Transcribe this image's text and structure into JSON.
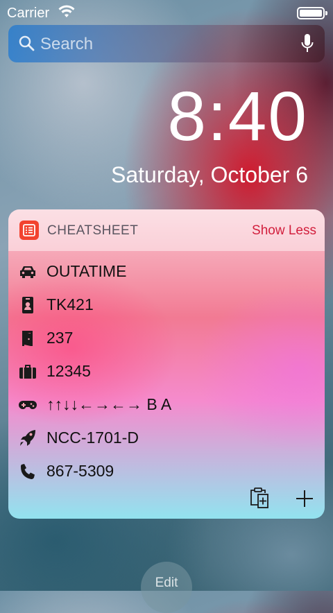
{
  "status_bar": {
    "carrier": "Carrier"
  },
  "search": {
    "placeholder": "Search"
  },
  "lockscreen": {
    "time": "8:40",
    "date": "Saturday, October 6"
  },
  "widget": {
    "app_name": "CHEATSHEET",
    "toggle_label": "Show Less",
    "items": [
      {
        "icon": "car-icon",
        "value": "OUTATIME"
      },
      {
        "icon": "id-badge-icon",
        "value": "TK421"
      },
      {
        "icon": "door-icon",
        "value": "237"
      },
      {
        "icon": "suitcase-icon",
        "value": "12345"
      },
      {
        "icon": "gamepad-icon",
        "value": "↑↑↓↓←→←→ B A"
      },
      {
        "icon": "rocket-icon",
        "value": "NCC-1701-D"
      },
      {
        "icon": "phone-icon",
        "value": "867-5309"
      }
    ]
  },
  "footer": {
    "edit_label": "Edit"
  },
  "colors": {
    "accent": "#d21e3c",
    "app_icon": "#f2432f"
  }
}
